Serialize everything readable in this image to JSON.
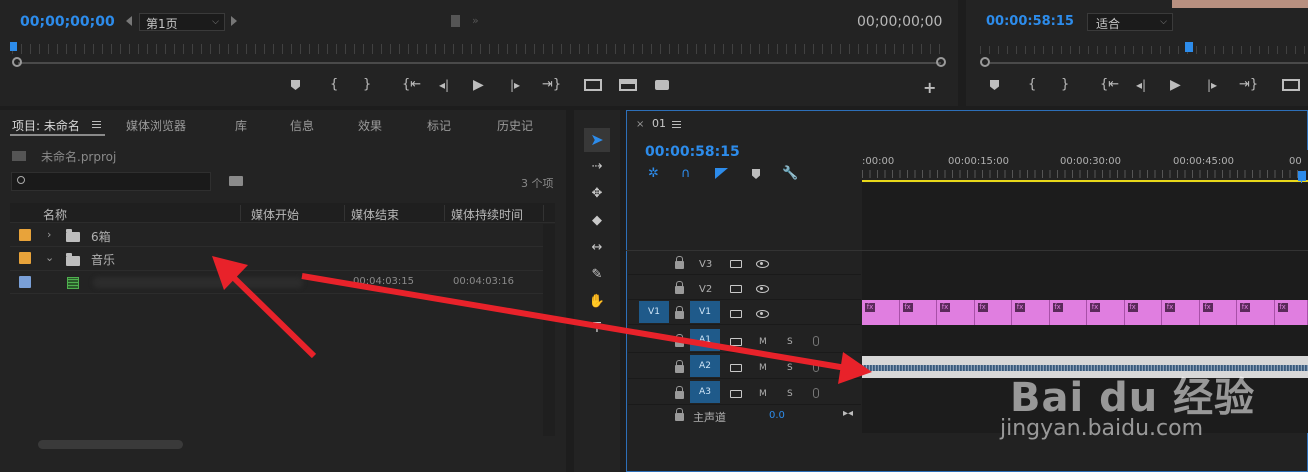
{
  "source_monitor": {
    "timecode_in": "00;00;00;00",
    "page_label": "第1页",
    "timecode_out": "00;00;00;00"
  },
  "program_monitor": {
    "timecode": "00:00:58:15",
    "zoom": "适合"
  },
  "transport_icons": [
    "marker-icon",
    "mark-in-icon",
    "mark-out-icon",
    "go-to-in-icon",
    "step-back-icon",
    "play-icon",
    "step-forward-icon",
    "go-to-out-icon",
    "insert-icon",
    "overwrite-icon",
    "export-frame-icon",
    "add-icon"
  ],
  "project_panel": {
    "tabs": [
      "项目: 未命名",
      "媒体浏览器",
      "库",
      "信息",
      "效果",
      "标记",
      "历史记"
    ],
    "project_file": "未命名.prproj",
    "item_count": "3 个项",
    "columns": [
      "名称",
      "媒体开始",
      "媒体结束",
      "媒体持续时间"
    ],
    "rows": [
      {
        "name": "6箱",
        "start": "",
        "end": "",
        "duration": "",
        "color": "#e8a33a",
        "type": "bin"
      },
      {
        "name": "音乐",
        "start": "",
        "end": "",
        "duration": "",
        "color": "#e8a33a",
        "type": "bin"
      },
      {
        "name": "",
        "start": "00:04:03:15",
        "end": "00:04:03:16",
        "duration": "",
        "color": "#7aa0d8",
        "type": "audio-clip"
      }
    ]
  },
  "timeline": {
    "sequence_name": "01",
    "timecode": "00:00:58:15",
    "ruler": [
      ":00:00",
      "00:00:15:00",
      "00:00:30:00",
      "00:00:45:00",
      "00"
    ],
    "video_tracks": [
      "V3",
      "V2",
      "V1"
    ],
    "audio_tracks": [
      "A1",
      "A2",
      "A3"
    ],
    "source_patch_v": "V1",
    "track_buttons": {
      "mute": "M",
      "solo": "S"
    },
    "master_label": "主声道",
    "master_value": "0.0"
  },
  "watermark": {
    "brand": "Bai du 经验",
    "url": "jingyan.baidu.com"
  },
  "colors": {
    "timecode_blue": "#2d8ceb",
    "clip_pink": "#e07ee0",
    "arrow_red": "#e8222a",
    "target_blue": "#1f5a8a"
  }
}
